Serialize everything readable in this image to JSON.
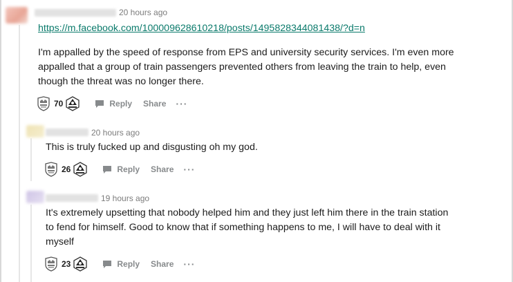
{
  "comments": [
    {
      "timestamp": "20 hours ago",
      "link": "https://m.facebook.com/100009628610218/posts/1495828344081438/?d=n",
      "lines": [
        "I'm appalled by the speed of response from EPS and university security services. I'm even more",
        "appalled that a group of train passengers prevented others from leaving the train to help, even",
        "though the threat was no longer there."
      ],
      "score": "70",
      "reply_label": "Reply",
      "share_label": "Share",
      "more_label": "···",
      "avatar_color": "#e8a596"
    },
    {
      "timestamp": "20 hours ago",
      "lines": [
        "This is truly fucked up and disgusting oh my god."
      ],
      "score": "26",
      "reply_label": "Reply",
      "share_label": "Share",
      "more_label": "···",
      "avatar_color": "#ece0b0"
    },
    {
      "timestamp": "19 hours ago",
      "lines": [
        "It's extremely upsetting that nobody helped him and they just left him there in the train station",
        "to fend for himself. Good to know that if something happens to me, I will have to deal with it",
        "myself"
      ],
      "score": "23",
      "reply_label": "Reply",
      "share_label": "Share",
      "more_label": "···",
      "avatar_color": "#c8bde0"
    }
  ],
  "icons": {
    "upvote": "shield-crest-icon",
    "downvote": "hex-badge-icon",
    "reply": "speech-bubble-icon"
  }
}
